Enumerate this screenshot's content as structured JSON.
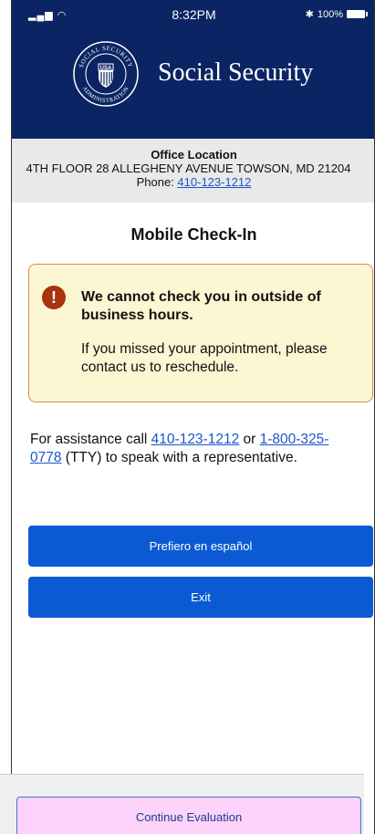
{
  "status_bar": {
    "signal": "▂▄▆ ◠",
    "time": "8:32PM",
    "bluetooth": "✱",
    "battery": "100%"
  },
  "header": {
    "logo_text": {
      "ring_top": "SOCIAL SECURITY",
      "ring_bottom": "ADMINISTRATION",
      "shield": "USA"
    },
    "title": "Social Security"
  },
  "office": {
    "title": "Office Location",
    "address": "4TH FLOOR 28 ALLEGHENY AVENUE TOWSON, MD 21204",
    "phone_label": "Phone: ",
    "phone": "410-123-1212"
  },
  "main": {
    "title": "Mobile Check-In",
    "alert": {
      "icon": "!",
      "heading": "We cannot check you in outside of business hours.",
      "body": "If you missed your appointment, please contact us to reschedule."
    },
    "assistance": {
      "prefix": "For assistance call ",
      "phone": "410-123-1212",
      "mid": " or ",
      "tty_phone": "1-800-325-0778",
      "suffix": " (TTY) to speak with a representative."
    },
    "buttons": {
      "spanish": "Prefiero en español",
      "exit": "Exit"
    }
  },
  "footer": {
    "continue": "Continue Evaluation"
  },
  "colors": {
    "header_bg": "#0b2463",
    "button_blue": "#0b5ad3",
    "alert_bg": "#fdf6d3",
    "alert_border": "#d48b4d",
    "alert_icon": "#a8330c",
    "continue_bg": "#fdd2fb"
  }
}
